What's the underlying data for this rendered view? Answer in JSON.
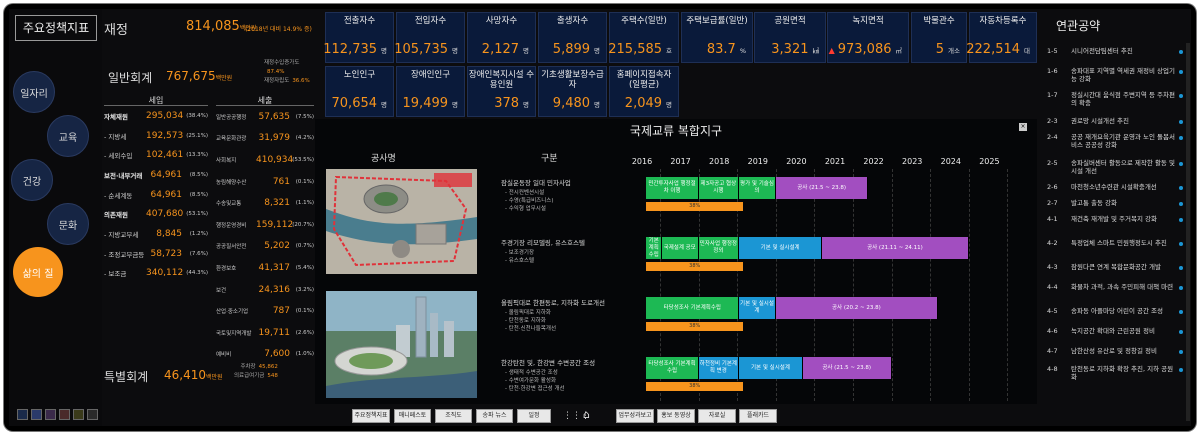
{
  "left": {
    "title": "주요정책지표",
    "menu": [
      "일자리",
      "교육",
      "건강",
      "문화",
      "삶의 질"
    ],
    "active": "삶의 질",
    "swatches": [
      "#1a2a4a",
      "#2a3a6a",
      "#3a2a4a",
      "#4a2a2a",
      "#3a3a1a",
      "#2a2a2a"
    ]
  },
  "finance": {
    "title": "재정",
    "total": "814,085",
    "total_unit": "백만원",
    "total_note": "(2018년 대비 14.9% 증)",
    "general_label": "일반회계",
    "general_value": "767,675",
    "general_unit": "백만원",
    "side_items": [
      {
        "label": "재정수입증가도",
        "value": "87.4%"
      },
      {
        "label": "재정자립도",
        "value": "36.6%"
      }
    ],
    "revenue_header": "세입",
    "revenue": [
      {
        "label": "자체재원",
        "value": "295,034",
        "pct": "(38.4%)",
        "bold": true
      },
      {
        "label": "- 지방세",
        "value": "192,573",
        "pct": "(25.1%)",
        "bold": false
      },
      {
        "label": "- 세외수입",
        "value": "102,461",
        "pct": "(13.3%)",
        "bold": false
      },
      {
        "label": "보전·내부거래",
        "value": "64,961",
        "pct": "(8.5%)",
        "bold": true
      },
      {
        "label": "- 순세계동",
        "value": "64,961",
        "pct": "(8.5%)",
        "bold": false
      },
      {
        "label": "의존재원",
        "value": "407,680",
        "pct": "(53.1%)",
        "bold": true
      },
      {
        "label": "- 지방교부세",
        "value": "8,845",
        "pct": "(1.2%)",
        "bold": false
      },
      {
        "label": "- 조정교부금등",
        "value": "58,723",
        "pct": "(7.6%)",
        "bold": false
      },
      {
        "label": "- 보조금",
        "value": "340,112",
        "pct": "(44.3%)",
        "bold": false
      }
    ],
    "expense_header": "세출",
    "expense": [
      {
        "label": "일반공공행정",
        "value": "57,635",
        "pct": "(7.5%)"
      },
      {
        "label": "교육문화관광",
        "value": "31,979",
        "pct": "(4.2%)"
      },
      {
        "label": "사회복지",
        "value": "410,934",
        "pct": "(53.5%)"
      },
      {
        "label": "농림해양수산",
        "value": "761",
        "pct": "(0.1%)"
      },
      {
        "label": "수송및교통",
        "value": "8,321",
        "pct": "(1.1%)"
      },
      {
        "label": "행정운영경비",
        "value": "159,112",
        "pct": "(20.7%)"
      },
      {
        "label": "공공질서안전",
        "value": "5,202",
        "pct": "(0.7%)"
      },
      {
        "label": "환경보호",
        "value": "41,317",
        "pct": "(5.4%)"
      },
      {
        "label": "보건",
        "value": "24,316",
        "pct": "(3.2%)"
      },
      {
        "label": "산업·중소기업",
        "value": "787",
        "pct": "(0.1%)"
      },
      {
        "label": "국토및지역개발",
        "value": "19,711",
        "pct": "(2.6%)"
      },
      {
        "label": "예비비",
        "value": "7,600",
        "pct": "(1.0%)"
      }
    ],
    "special_label": "특별회계",
    "special_value": "46,410",
    "special_unit": "백만원",
    "special_side": [
      {
        "label": "주차장",
        "value": "45,862"
      },
      {
        "label": "의료급여기금",
        "value": "548"
      }
    ]
  },
  "stats": [
    {
      "title": "전출자수",
      "value": "112,735",
      "unit": "명"
    },
    {
      "title": "전입자수",
      "value": "105,735",
      "unit": "명"
    },
    {
      "title": "사망자수",
      "value": "2,127",
      "unit": "명"
    },
    {
      "title": "출생자수",
      "value": "5,899",
      "unit": "명"
    },
    {
      "title": "주택수(일반)",
      "value": "215,585",
      "unit": "호"
    },
    {
      "title": "주택보급률(일반)",
      "value": "83.7",
      "unit": "%"
    },
    {
      "title": "공원면적",
      "value": "3,321",
      "unit": "㎢"
    },
    {
      "title": "녹지면적",
      "value": "973,086",
      "unit": "㎡",
      "trend": "▲"
    },
    {
      "title": "박물관수",
      "value": "5",
      "unit": "개소"
    },
    {
      "title": "자동차등록수",
      "value": "222,514",
      "unit": "대"
    },
    {
      "title": "노인인구",
      "value": "70,654",
      "unit": "명"
    },
    {
      "title": "장애인인구",
      "value": "19,499",
      "unit": "명"
    },
    {
      "title": "장애인복지시설 수용인원",
      "value": "378",
      "unit": "명"
    },
    {
      "title": "기초생활보장수급자",
      "value": "9,480",
      "unit": "명"
    },
    {
      "title": "홈페이지접속자 (일평균)",
      "value": "2,049",
      "unit": "명"
    }
  ],
  "project": {
    "title": "국제교류 복합지구",
    "photo_header": "공사명",
    "gubun_header": "구분",
    "years": [
      "2016",
      "2017",
      "2018",
      "2019",
      "2020",
      "2021",
      "2022",
      "2023",
      "2024",
      "2025"
    ],
    "rows": [
      {
        "name": "잠실운동장 일대 민자사업",
        "subs": [
          "- 전시컨벤션시설",
          "- 수영(특급비즈니스)",
          "- 수익형 업무시설"
        ],
        "bars": [
          {
            "text": "민간투자사업 행정절차 이행",
            "color": "g"
          },
          {
            "text": "제3자공고 협상시행",
            "color": "g"
          },
          {
            "text": "평가 및 기술심의",
            "color": "g"
          },
          {
            "text": "공사 (21.5 ~ 23.8)",
            "color": "p"
          }
        ],
        "progress": "38%"
      },
      {
        "name": "주경기장 리모델링, 유스호스텔",
        "subs": [
          "- 보조경기장",
          "- 유스호스텔"
        ],
        "bars": [
          {
            "text": "기본계획 수립",
            "color": "g"
          },
          {
            "text": "국제설계 공모",
            "color": "g"
          },
          {
            "text": "민자사업 행정정정외",
            "color": "g"
          },
          {
            "text": "기본 및 실시설계",
            "color": "b"
          },
          {
            "text": "공사 (21.11 ~ 24.11)",
            "color": "p"
          }
        ],
        "progress": "38%"
      },
      {
        "name": "올림픽대로 한편동로, 지하화 도로개선",
        "subs": [
          "- 올림픽대로 지하화",
          "- 탄천동로 지하화",
          "- 탄천·신천나들목개선"
        ],
        "bars": [
          {
            "text": "타당성조사 기본계획수립",
            "color": "g"
          },
          {
            "text": "기본 및 실시설계",
            "color": "b"
          },
          {
            "text": "공사 (20.2 ~ 23.8)",
            "color": "p"
          }
        ],
        "progress": "38%"
      },
      {
        "name": "한강탄천 및, 한강변 수변공간 조성",
        "subs": [
          "- 생태적 수변공간 조성",
          "- 수변여가문화 활성화",
          "- 탄천·한강변 접근성 개선"
        ],
        "bars": [
          {
            "text": "타당성조사 기본계획수립",
            "color": "g"
          },
          {
            "text": "하천정비 기본계획 변경",
            "color": "b"
          },
          {
            "text": "기본 및 실시설계",
            "color": "b"
          },
          {
            "text": "공사 (21.5 ~ 23.8)",
            "color": "p"
          }
        ],
        "progress": "38%"
      }
    ]
  },
  "bottom_nav": {
    "left": [
      "주요정책지표",
      "매니페스토",
      "조직도",
      "송파 뉴스",
      "일정"
    ],
    "right": [
      "업무성과보고",
      "홍보 동영상",
      "자료실",
      "플래카드"
    ]
  },
  "right": {
    "title": "연관공약",
    "items": [
      {
        "no": "1-5",
        "text": "시니어전담팀센터 추진"
      },
      {
        "no": "1-6",
        "text": "송파대표 지역별 역세권 재정비 상업기능 강화"
      },
      {
        "no": "1-7",
        "text": "정실시간대 움식점 주변지역 등 주차편의 확충"
      },
      {
        "no": "2-3",
        "text": "권로망 시설개선 추진"
      },
      {
        "no": "2-4",
        "text": "공공 재개요육기관 운영과 노인 돌봄서비스 공공성 강화"
      },
      {
        "no": "2-5",
        "text": "송파실버센터 활동으로 제작한 활동 및 시설 개선"
      },
      {
        "no": "2-6",
        "text": "마천청소년수련관 시설확충개선"
      },
      {
        "no": "2-7",
        "text": "발고통 출동 강화"
      },
      {
        "no": "4-1",
        "text": "재건축 재개발 및 주거복지 강화"
      },
      {
        "no": "4-2",
        "text": "특정업체 스마트 민원행정도시 추진"
      },
      {
        "no": "4-3",
        "text": "잠원다큰 연계 복합문화공간 개발"
      },
      {
        "no": "4-4",
        "text": "화물차 과적, 과속 주민피해 대책 마련"
      },
      {
        "no": "4-5",
        "text": "송파동 아플마당 어린이 공간 조성"
      },
      {
        "no": "4-6",
        "text": "녹지공간 확대와 근린공원 정비"
      },
      {
        "no": "4-7",
        "text": "남한산성 유산로 및 정창길 정비"
      },
      {
        "no": "4-8",
        "text": "탄천동로 지하화 확장 추진, 지하 공원화"
      }
    ]
  }
}
